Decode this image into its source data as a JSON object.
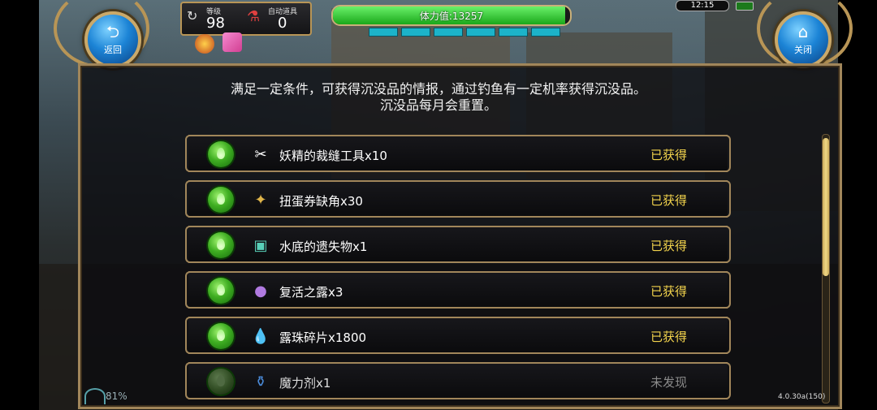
{
  "hud": {
    "level_label": "等级",
    "level_value": "98",
    "auto_item_label": "自动道具",
    "auto_item_value": "0",
    "stamina_text": "体力值:13257",
    "stamina_fraction": 0.98,
    "time": "12:15",
    "network_percent": "81%",
    "version": "4.0.30a(150)"
  },
  "buttons": {
    "back_label": "返回",
    "close_label": "关闭"
  },
  "description": {
    "line1": "满足一定条件，可获得沉没品的情报，通过钓鱼有一定机率获得沉没品。",
    "line2": "沉没品每月会重置。"
  },
  "items": [
    {
      "name": "妖精的裁缝工具x10",
      "status": "已获得",
      "icon": "scissors-icon"
    },
    {
      "name": "扭蛋券缺角x30",
      "status": "已获得",
      "icon": "ticket-fragment-icon"
    },
    {
      "name": "水底的遗失物x1",
      "status": "已获得",
      "icon": "treasure-chest-icon"
    },
    {
      "name": "复活之露x3",
      "status": "已获得",
      "icon": "dark-orb-icon"
    },
    {
      "name": "露珠碎片x1800",
      "status": "已获得",
      "icon": "dew-drops-icon"
    },
    {
      "name": "魔力剂x1",
      "status": "未发现",
      "icon": "potion-flask-icon"
    }
  ],
  "colors": {
    "status_obtained": "#f2d34c",
    "status_undiscovered": "#8b8b8b",
    "frame_gold": "#a1865a"
  }
}
